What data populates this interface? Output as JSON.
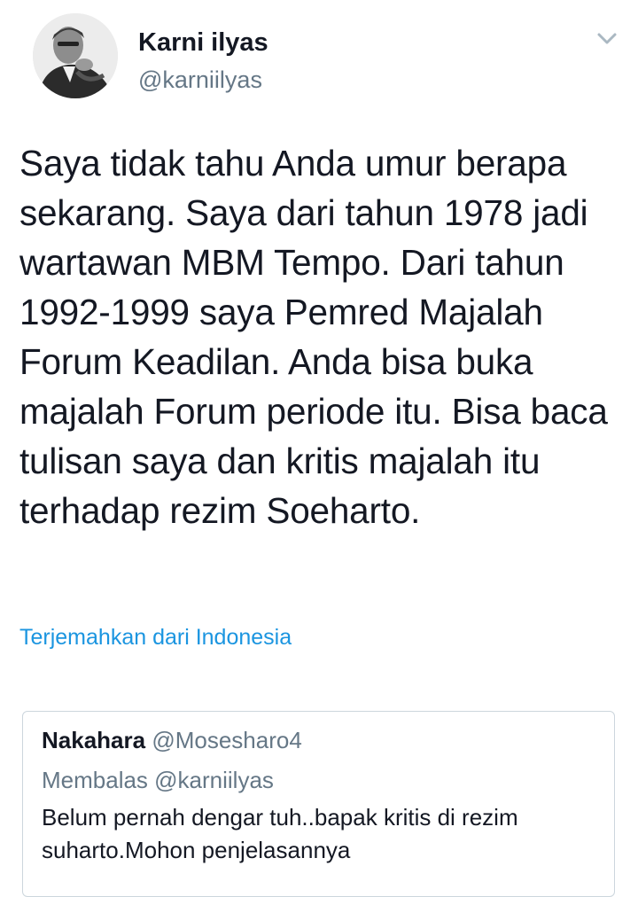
{
  "tweet": {
    "author_name": "Karni ilyas",
    "author_handle": "@karniilyas",
    "text": "Saya tidak tahu Anda umur berapa sekarang. Saya dari tahun 1978 jadi wartawan MBM Tempo. Dari tahun 1992-1999 saya Pemred Majalah Forum Keadilan. Anda bisa buka majalah Forum periode itu. Bisa baca tulisan saya dan kritis majalah itu terhadap rezim Soeharto.",
    "translate_link": "Terjemahkan dari Indonesia"
  },
  "quoted": {
    "author_name": "Nakahara",
    "author_handle": "@Mosesharo4",
    "reply_to": "Membalas @karniilyas",
    "text": "Belum pernah dengar tuh..bapak kritis di rezim suharto.Mohon penjelasannya"
  },
  "colors": {
    "text": "#141823",
    "secondary": "#657786",
    "link": "#1b95e0",
    "border": "#ccd6dd"
  },
  "icons": {
    "caret": "chevron-down-icon",
    "avatar": "profile-photo"
  }
}
